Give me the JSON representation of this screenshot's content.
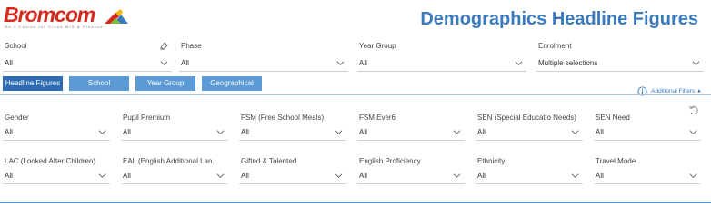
{
  "brand": {
    "name": "Bromcom",
    "tagline": "No.1 Choice for Cloud MIS & Finance",
    "color": "#d52b1e"
  },
  "header": {
    "title": "Demographics Headline Figures",
    "title_color": "#3a7abf"
  },
  "top_filters": [
    {
      "label": "School",
      "value": "All"
    },
    {
      "label": "Phase",
      "value": "All"
    },
    {
      "label": "Year Group",
      "value": "All"
    },
    {
      "label": "Enrolment",
      "value": "Multiple selections"
    }
  ],
  "tabs": [
    {
      "label": "Headline Figures",
      "active": true
    },
    {
      "label": "School"
    },
    {
      "label": "Year Group"
    },
    {
      "label": "Geographical"
    }
  ],
  "additional_filters": {
    "label": "Additional Filters",
    "icon": "info-icon"
  },
  "filters_row1": [
    {
      "label": "Gender",
      "value": "All"
    },
    {
      "label": "Pupil Premium",
      "value": "All"
    },
    {
      "label": "FSM (Free School Meals)",
      "value": "All"
    },
    {
      "label": "FSM Ever6",
      "value": "All"
    },
    {
      "label": "SEN (Special Educatio Needs)",
      "value": "All"
    },
    {
      "label": "SEN Need",
      "value": "All"
    }
  ],
  "filters_row2": [
    {
      "label": "LAC (Looked After Children)",
      "value": "All"
    },
    {
      "label": "EAL (English Additional Lan...",
      "value": "All"
    },
    {
      "label": "Gifted & Talented",
      "value": "All"
    },
    {
      "label": "English Proficiency",
      "value": "All"
    },
    {
      "label": "Ethnicity",
      "value": "All"
    },
    {
      "label": "Travel Mode",
      "value": "All"
    }
  ],
  "colors": {
    "accent": "#5b9bd5",
    "accent_dark": "#2e6db3"
  }
}
